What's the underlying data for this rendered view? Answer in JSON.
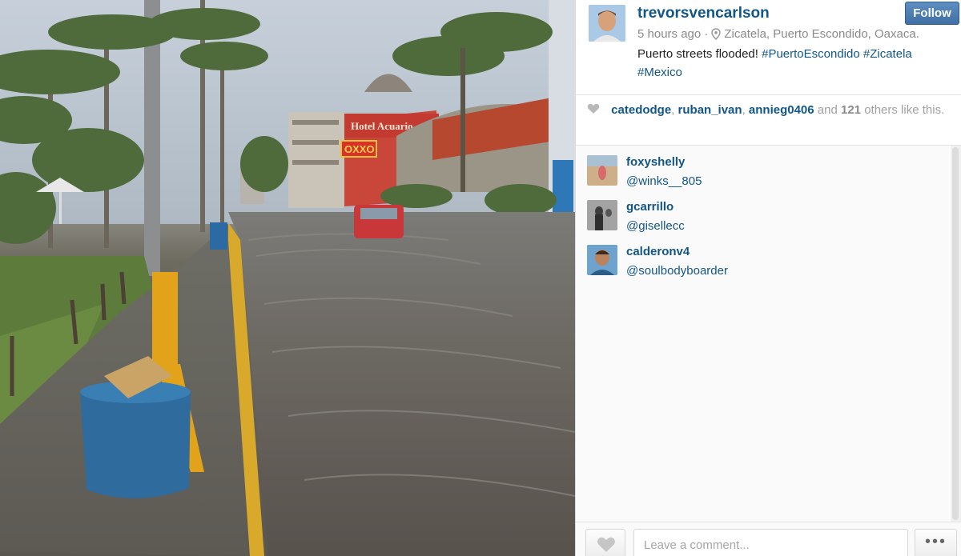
{
  "photo": {
    "hotel_sign": "Hotel Acuario",
    "store_sign": "OXXO"
  },
  "post": {
    "username": "trevorsvencarlson",
    "follow_label": "Follow",
    "time": "5 hours ago ·",
    "location": "Zicatela, Puerto Escondido, Oaxaca.",
    "caption_text": "Puerto streets flooded!",
    "hashtags": [
      "#PuertoEscondido",
      "#Zicatela",
      "#Mexico"
    ]
  },
  "likes": {
    "likers": [
      "catedodge",
      "ruban_ivan",
      "annieg0406"
    ],
    "sep": ",",
    "and_text": "and",
    "others_count": "121",
    "others_text": "others like this."
  },
  "comments": [
    {
      "username": "foxyshelly",
      "text": "@winks__805",
      "avatar_color": "#c9a77a"
    },
    {
      "username": "gcarrillo",
      "text": "@gisellecc",
      "avatar_color": "#6d6d6d"
    },
    {
      "username": "calderonv4",
      "text": "@soulbodyboarder",
      "avatar_color": "#5b8fb8"
    }
  ],
  "footer": {
    "comment_placeholder": "Leave a comment...",
    "more_label": "•••"
  },
  "colors": {
    "link": "#125688",
    "follow_bg": "#4a7ab0"
  },
  "icons": [
    "pin-icon",
    "heart-icon",
    "more-icon"
  ]
}
